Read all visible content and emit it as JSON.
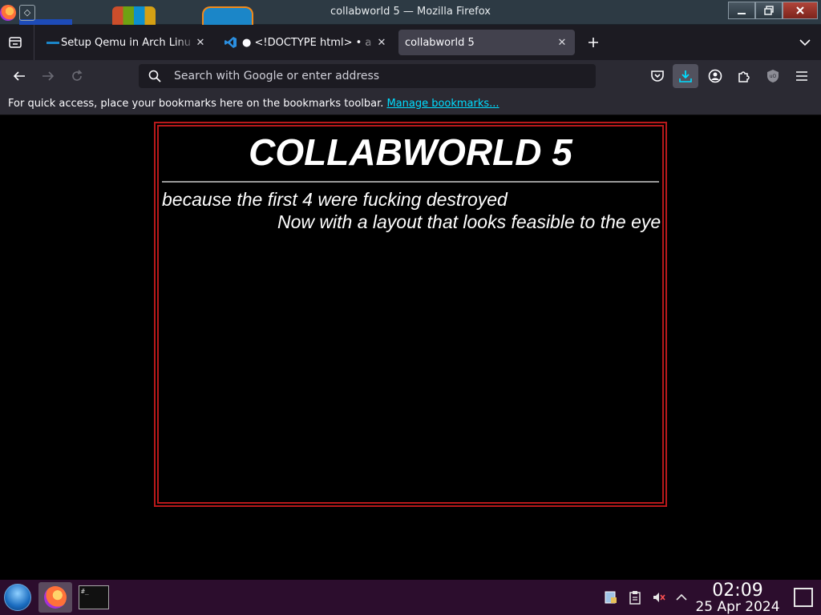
{
  "window": {
    "title": "collabworld 5 — Mozilla Firefox",
    "buttons": [
      "minimize",
      "maximize",
      "close"
    ]
  },
  "tabs": [
    {
      "label": "Setup Qemu in Arch Linu",
      "icon": "qemu-icon",
      "active": false
    },
    {
      "label": "● <!DOCTYPE html> • a",
      "icon": "vscode-icon",
      "active": false
    },
    {
      "label": "collabworld 5",
      "icon": "",
      "active": true
    }
  ],
  "navbar": {
    "url_placeholder": "Search with Google or enter address",
    "url_value": ""
  },
  "bookmarks": {
    "message": "For quick access, place your bookmarks here on the bookmarks toolbar.",
    "link": "Manage bookmarks..."
  },
  "page": {
    "title": "COLLABWORLD 5",
    "line1": "because the first 4 were fucking destroyed",
    "line2": "Now with a layout that looks feasible to the eye",
    "frame_color": "#b8191b"
  },
  "taskbar": {
    "time": "02:09",
    "date": "25 Apr 2024",
    "items": [
      "firefox",
      "terminal"
    ]
  },
  "colors": {
    "tab_bg": "#1c1b22",
    "toolbar_bg": "#2b2a33",
    "active_tab": "#42414d",
    "link": "#00ddff",
    "taskbar_bg": "#2c0d2d"
  }
}
